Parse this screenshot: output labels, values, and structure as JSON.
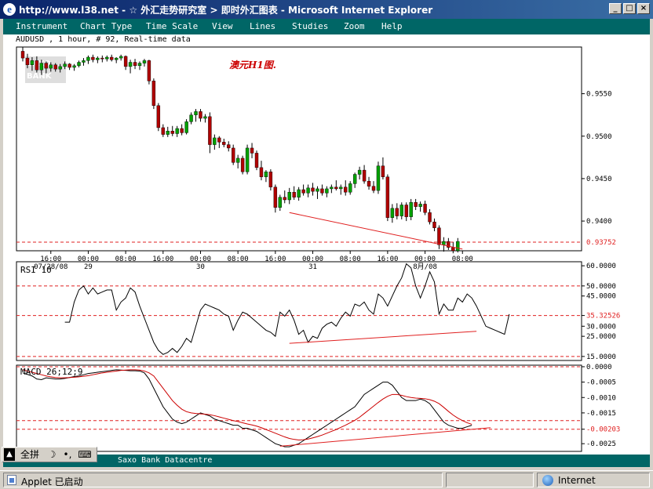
{
  "window": {
    "title": "http://www.l38.net - ☆ 外汇走势研究室 > 即时外汇图表 - Microsoft Internet Explorer",
    "controls": [
      "_",
      "□",
      "×"
    ]
  },
  "menu": [
    "Instrument",
    "Chart Type",
    "Time Scale",
    "View",
    "Lines",
    "Studies",
    "Zoom",
    "Help"
  ],
  "info_line": "AUDUSD , 1 hour, # 92, Real-time data",
  "footer_text": "Saxo Bank Datacentre",
  "ime": {
    "labels": [
      "全拼",
      "☽",
      "•,",
      "⌨"
    ]
  },
  "status": {
    "left": "Applet 已启动",
    "zone": "Internet"
  },
  "colors": {
    "up": "#00a000",
    "down": "#b00000",
    "ref_line": "#e02020",
    "trend": "#e02020",
    "teal": "#006666"
  },
  "chart_data": [
    {
      "type": "candlestick",
      "title": "澳元H1图.",
      "watermark": "SAXO BANK",
      "ylim": [
        0.9365,
        0.9605
      ],
      "y_ticks": [
        "0.9550",
        "0.9500",
        "0.9450",
        "0.9400"
      ],
      "ref_line": {
        "value": 0.93752,
        "label": "0.93752"
      },
      "x_ticks": [
        {
          "i": 6,
          "label": "16:00",
          "sub": "07/28/08"
        },
        {
          "i": 14,
          "label": "00:00",
          "sub": "29"
        },
        {
          "i": 22,
          "label": "08:00",
          "sub": ""
        },
        {
          "i": 30,
          "label": "16:00",
          "sub": ""
        },
        {
          "i": 38,
          "label": "00:00",
          "sub": "30"
        },
        {
          "i": 46,
          "label": "08:00",
          "sub": ""
        },
        {
          "i": 54,
          "label": "16:00",
          "sub": ""
        },
        {
          "i": 62,
          "label": "00:00",
          "sub": "31"
        },
        {
          "i": 70,
          "label": "08:00",
          "sub": ""
        },
        {
          "i": 78,
          "label": "16:00",
          "sub": ""
        },
        {
          "i": 86,
          "label": "00:00",
          "sub": "8月/08"
        },
        {
          "i": 94,
          "label": "08:00",
          "sub": ""
        }
      ],
      "candles": [
        [
          0.96,
          0.9605,
          0.9588,
          0.9592
        ],
        [
          0.9592,
          0.9597,
          0.958,
          0.9584
        ],
        [
          0.9584,
          0.9593,
          0.9577,
          0.9589
        ],
        [
          0.9589,
          0.9594,
          0.9575,
          0.9578
        ],
        [
          0.9578,
          0.959,
          0.9572,
          0.9586
        ],
        [
          0.9586,
          0.9588,
          0.9574,
          0.958
        ],
        [
          0.958,
          0.9587,
          0.9576,
          0.9584
        ],
        [
          0.9584,
          0.9586,
          0.9576,
          0.9579
        ],
        [
          0.9579,
          0.9585,
          0.9575,
          0.9582
        ],
        [
          0.9582,
          0.9588,
          0.9579,
          0.9585
        ],
        [
          0.9585,
          0.9586,
          0.9578,
          0.9581
        ],
        [
          0.9581,
          0.9585,
          0.9577,
          0.9583
        ],
        [
          0.9583,
          0.9589,
          0.9581,
          0.9587
        ],
        [
          0.9587,
          0.9592,
          0.9583,
          0.9589
        ],
        [
          0.9589,
          0.9595,
          0.9585,
          0.9593
        ],
        [
          0.9593,
          0.9596,
          0.9587,
          0.959
        ],
        [
          0.959,
          0.9594,
          0.9586,
          0.9592
        ],
        [
          0.9592,
          0.9595,
          0.9587,
          0.9591
        ],
        [
          0.9591,
          0.9595,
          0.9588,
          0.9593
        ],
        [
          0.9593,
          0.9596,
          0.9588,
          0.959
        ],
        [
          0.959,
          0.9593,
          0.9586,
          0.9592
        ],
        [
          0.9592,
          0.9596,
          0.9589,
          0.9594
        ],
        [
          0.9594,
          0.9595,
          0.9578,
          0.9582
        ],
        [
          0.9582,
          0.959,
          0.9574,
          0.9587
        ],
        [
          0.9587,
          0.9591,
          0.9579,
          0.9583
        ],
        [
          0.9583,
          0.9588,
          0.9578,
          0.9586
        ],
        [
          0.9586,
          0.9591,
          0.9582,
          0.9589
        ],
        [
          0.9589,
          0.959,
          0.9561,
          0.9565
        ],
        [
          0.9565,
          0.9568,
          0.9532,
          0.9536
        ],
        [
          0.9536,
          0.9539,
          0.9506,
          0.951
        ],
        [
          0.951,
          0.9514,
          0.9499,
          0.9502
        ],
        [
          0.9502,
          0.9511,
          0.9499,
          0.9506
        ],
        [
          0.9506,
          0.9512,
          0.95,
          0.9503
        ],
        [
          0.9503,
          0.9512,
          0.9499,
          0.9509
        ],
        [
          0.9509,
          0.9514,
          0.9501,
          0.9504
        ],
        [
          0.9504,
          0.952,
          0.9502,
          0.9517
        ],
        [
          0.9517,
          0.9528,
          0.9514,
          0.9525
        ],
        [
          0.9525,
          0.9532,
          0.9517,
          0.9529
        ],
        [
          0.9529,
          0.9532,
          0.9517,
          0.9521
        ],
        [
          0.9521,
          0.9526,
          0.9516,
          0.9523
        ],
        [
          0.9523,
          0.9528,
          0.948,
          0.949
        ],
        [
          0.949,
          0.9502,
          0.9484,
          0.9498
        ],
        [
          0.9498,
          0.95,
          0.9486,
          0.9493
        ],
        [
          0.9493,
          0.9497,
          0.9487,
          0.949
        ],
        [
          0.949,
          0.9494,
          0.9482,
          0.9486
        ],
        [
          0.9486,
          0.949,
          0.9466,
          0.9469
        ],
        [
          0.9469,
          0.9478,
          0.9462,
          0.9474
        ],
        [
          0.9474,
          0.9477,
          0.9455,
          0.9458
        ],
        [
          0.9458,
          0.949,
          0.9455,
          0.9486
        ],
        [
          0.9486,
          0.9492,
          0.9474,
          0.948
        ],
        [
          0.948,
          0.9483,
          0.946,
          0.9463
        ],
        [
          0.9463,
          0.9471,
          0.9448,
          0.9452
        ],
        [
          0.9452,
          0.946,
          0.9446,
          0.9458
        ],
        [
          0.9458,
          0.9461,
          0.9436,
          0.944
        ],
        [
          0.944,
          0.9443,
          0.941,
          0.9416
        ],
        [
          0.9416,
          0.9431,
          0.9412,
          0.9428
        ],
        [
          0.9428,
          0.9436,
          0.9421,
          0.9425
        ],
        [
          0.9425,
          0.9439,
          0.942,
          0.9434
        ],
        [
          0.9434,
          0.9441,
          0.9425,
          0.9428
        ],
        [
          0.9428,
          0.944,
          0.9424,
          0.9437
        ],
        [
          0.9437,
          0.9443,
          0.943,
          0.9433
        ],
        [
          0.9433,
          0.9443,
          0.9428,
          0.9439
        ],
        [
          0.9439,
          0.9445,
          0.943,
          0.9435
        ],
        [
          0.9435,
          0.9441,
          0.9426,
          0.9438
        ],
        [
          0.9438,
          0.9443,
          0.943,
          0.9433
        ],
        [
          0.9433,
          0.9441,
          0.9428,
          0.9438
        ],
        [
          0.9438,
          0.9443,
          0.9433,
          0.944
        ],
        [
          0.944,
          0.9448,
          0.9436,
          0.9438
        ],
        [
          0.9438,
          0.9443,
          0.9431,
          0.944
        ],
        [
          0.944,
          0.9448,
          0.943,
          0.9434
        ],
        [
          0.9434,
          0.9447,
          0.9431,
          0.9444
        ],
        [
          0.9444,
          0.9457,
          0.9439,
          0.9455
        ],
        [
          0.9455,
          0.9464,
          0.9449,
          0.946
        ],
        [
          0.946,
          0.9466,
          0.9444,
          0.9447
        ],
        [
          0.9447,
          0.9452,
          0.9437,
          0.9441
        ],
        [
          0.9441,
          0.9447,
          0.9433,
          0.9436
        ],
        [
          0.9436,
          0.947,
          0.9432,
          0.9465
        ],
        [
          0.9465,
          0.9475,
          0.9449,
          0.9452
        ],
        [
          0.9452,
          0.9455,
          0.94,
          0.9404
        ],
        [
          0.9404,
          0.942,
          0.9398,
          0.9415
        ],
        [
          0.9415,
          0.9421,
          0.9402,
          0.9406
        ],
        [
          0.9406,
          0.9422,
          0.9402,
          0.9419
        ],
        [
          0.9419,
          0.9422,
          0.94,
          0.9405
        ],
        [
          0.9405,
          0.9426,
          0.9401,
          0.9422
        ],
        [
          0.9422,
          0.9426,
          0.9413,
          0.9417
        ],
        [
          0.9417,
          0.9423,
          0.9411,
          0.942
        ],
        [
          0.942,
          0.9424,
          0.9407,
          0.941
        ],
        [
          0.941,
          0.9414,
          0.9396,
          0.9399
        ],
        [
          0.9399,
          0.9403,
          0.9388,
          0.9392
        ],
        [
          0.9392,
          0.9395,
          0.9367,
          0.9372
        ],
        [
          0.9372,
          0.9381,
          0.9364,
          0.9376
        ],
        [
          0.9376,
          0.938,
          0.9366,
          0.9369
        ],
        [
          0.9369,
          0.9375,
          0.9362,
          0.9365
        ],
        [
          0.9365,
          0.938,
          0.9363,
          0.9376
        ]
      ],
      "trendline": {
        "from": [
          57,
          0.941
        ],
        "to": [
          94,
          0.9367
        ]
      }
    },
    {
      "type": "line",
      "title": "RSI 10",
      "ylim": [
        13,
        62
      ],
      "y_ticks": [
        {
          "v": 60,
          "label": "60.0000"
        },
        {
          "v": 50,
          "label": "50.0000"
        },
        {
          "v": 45,
          "label": "45.0000"
        },
        {
          "v": 35.32526,
          "label": "35.32526"
        },
        {
          "v": 30,
          "label": "30.0000"
        },
        {
          "v": 25,
          "label": "25.0000"
        },
        {
          "v": 15,
          "label": "15.0000"
        }
      ],
      "ref_lines": [
        50,
        35.32526,
        15
      ],
      "start": 11,
      "values": [
        32,
        32,
        42,
        48,
        50,
        46,
        49,
        46,
        47,
        48,
        48,
        38,
        42,
        44,
        49,
        47,
        40,
        34,
        28,
        22,
        18,
        16,
        17,
        19,
        17,
        20,
        24,
        22,
        30,
        38,
        41,
        40,
        39,
        38,
        36,
        35,
        28,
        33,
        37,
        36,
        34,
        32,
        30,
        28,
        27,
        25,
        37,
        35,
        38,
        33,
        26,
        28,
        22,
        25,
        24,
        29,
        31,
        32,
        30,
        34,
        37,
        35,
        41,
        40,
        42,
        38,
        36,
        46,
        44,
        40,
        45,
        50,
        54,
        61,
        59,
        50,
        44,
        50,
        57,
        52,
        36,
        41,
        38,
        38,
        44,
        42,
        46,
        44,
        40,
        35,
        30,
        29,
        28,
        27,
        26,
        36
      ],
      "trendline": {
        "from": [
          57,
          21.5
        ],
        "to": [
          97,
          27.5
        ]
      }
    },
    {
      "type": "line",
      "title": "MACD 26;12;9",
      "ylim": [
        -0.00275,
        5e-05
      ],
      "y_ticks": [
        {
          "v": 0,
          "label": "0.0000"
        },
        {
          "v": -0.0005,
          "label": "-0.0005"
        },
        {
          "v": -0.001,
          "label": "-0.0010"
        },
        {
          "v": -0.0015,
          "label": "-0.0015"
        },
        {
          "v": -0.00203,
          "label": "-0.00203"
        },
        {
          "v": -0.0025,
          "label": "-0.0025"
        }
      ],
      "ref_lines": [
        0,
        -0.00175,
        -0.00203
      ],
      "series": [
        {
          "name": "MACD",
          "color": "#000000",
          "values": [
            -0.0002,
            -0.00025,
            -0.0003,
            -0.0004,
            -0.00042,
            -0.00036,
            -0.00038,
            -0.0004,
            -0.0004,
            -0.00038,
            -0.00035,
            -0.00032,
            -0.0003,
            -0.00026,
            -0.00022,
            -0.0002,
            -0.00018,
            -0.00016,
            -0.00014,
            -0.00012,
            -0.0001,
            -0.00011,
            -0.00012,
            -0.00013,
            -0.00013,
            -0.00014,
            -0.0002,
            -0.0004,
            -0.0007,
            -0.001,
            -0.0013,
            -0.0015,
            -0.0017,
            -0.0018,
            -0.00185,
            -0.0018,
            -0.0017,
            -0.0016,
            -0.0015,
            -0.00155,
            -0.0016,
            -0.0017,
            -0.00175,
            -0.0018,
            -0.00185,
            -0.0019,
            -0.0019,
            -0.002,
            -0.002,
            -0.00205,
            -0.0021,
            -0.0022,
            -0.0023,
            -0.0024,
            -0.0025,
            -0.00255,
            -0.0026,
            -0.0026,
            -0.00255,
            -0.0025,
            -0.0024,
            -0.0023,
            -0.0022,
            -0.0021,
            -0.002,
            -0.0019,
            -0.0018,
            -0.0017,
            -0.0016,
            -0.0015,
            -0.0014,
            -0.0013,
            -0.0011,
            -0.0009,
            -0.0008,
            -0.0007,
            -0.0006,
            -0.0005,
            -0.0005,
            -0.0006,
            -0.0008,
            -0.001,
            -0.0011,
            -0.0011,
            -0.0011,
            -0.00105,
            -0.0011,
            -0.0012,
            -0.0014,
            -0.0016,
            -0.0018,
            -0.0019,
            -0.00195,
            -0.002,
            -0.002,
            -0.00195,
            -0.0019
          ]
        },
        {
          "name": "Signal",
          "color": "#cc0000",
          "values": [
            -0.0001,
            -0.00014,
            -0.00018,
            -0.00022,
            -0.00026,
            -0.0003,
            -0.00033,
            -0.00035,
            -0.00036,
            -0.00036,
            -0.00035,
            -0.00034,
            -0.00033,
            -0.00031,
            -0.00029,
            -0.00026,
            -0.00023,
            -0.0002,
            -0.00018,
            -0.00016,
            -0.00014,
            -0.00012,
            -0.00011,
            -0.0001,
            -0.0001,
            -0.00011,
            -0.00014,
            -0.0002,
            -0.0003,
            -0.0005,
            -0.0007,
            -0.0009,
            -0.0011,
            -0.00125,
            -0.00138,
            -0.00146,
            -0.0015,
            -0.00152,
            -0.00153,
            -0.00154,
            -0.00156,
            -0.00159,
            -0.00163,
            -0.00167,
            -0.00171,
            -0.00175,
            -0.00178,
            -0.00182,
            -0.00186,
            -0.00189,
            -0.00193,
            -0.00198,
            -0.00204,
            -0.0021,
            -0.00216,
            -0.00222,
            -0.00228,
            -0.00233,
            -0.00236,
            -0.00238,
            -0.00237,
            -0.00235,
            -0.00231,
            -0.00227,
            -0.00222,
            -0.00216,
            -0.0021,
            -0.00204,
            -0.00197,
            -0.0019,
            -0.00182,
            -0.00174,
            -0.00164,
            -0.00152,
            -0.0014,
            -0.00128,
            -0.00116,
            -0.00105,
            -0.00096,
            -0.0009,
            -0.0009,
            -0.00093,
            -0.00097,
            -0.001,
            -0.00102,
            -0.00103,
            -0.00104,
            -0.00107,
            -0.00112,
            -0.0012,
            -0.00132,
            -0.00145,
            -0.00157,
            -0.00167,
            -0.00175,
            -0.00182,
            -0.00187
          ]
        }
      ],
      "trendline": {
        "from": [
          55,
          -0.00258
        ],
        "to": [
          100,
          -0.00198
        ]
      }
    }
  ]
}
